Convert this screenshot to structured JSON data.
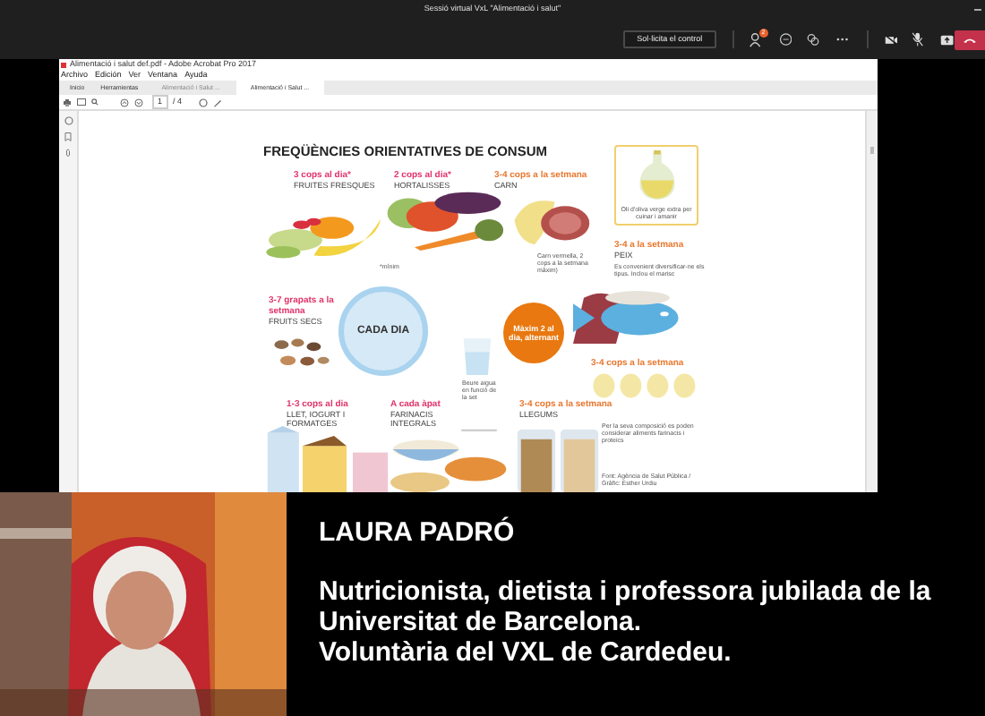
{
  "window": {
    "title": "Sessió virtual VxL \"Alimentació i salut\""
  },
  "toolbar": {
    "control_button": "Sol·licita el control",
    "participants_badge": "2"
  },
  "viewer": {
    "title": "Alimentació i salut def.pdf - Adobe Acrobat Pro 2017",
    "menu": [
      "Archivo",
      "Edición",
      "Ver",
      "Ventana",
      "Ayuda"
    ],
    "tabs": [
      {
        "label": "Inicio",
        "selected": false
      },
      {
        "label": "Herramientas",
        "selected": false
      },
      {
        "label": "Alimentació i Salut ...",
        "selected": false
      },
      {
        "label": "Alimentació i Salut ...",
        "selected": true
      }
    ],
    "page": "1",
    "page_total": "/ 4"
  },
  "poster": {
    "title": "FREQÜÈNCIES ORIENTATIVES DE CONSUM",
    "groups": [
      {
        "frequency": "3 cops al dia*",
        "food": "FRUITES FRESQUES",
        "color": "#e0336a"
      },
      {
        "frequency": "2 cops al dia*",
        "food": "HORTALISSES",
        "color": "#e0336a"
      },
      {
        "frequency": "3-4  cops a la setmana",
        "food": "CARN",
        "color": "#e8772e"
      },
      {
        "frequency": "3-4 a la setmana",
        "food": "PEIX",
        "color": "#e8772e"
      },
      {
        "frequency": "3-7 grapats a la setmana",
        "food": "FRUITS SECS",
        "color": "#e0336a"
      },
      {
        "frequency": "3-4 cops a la setmana",
        "color": "#e8772e"
      },
      {
        "frequency": "1-3 cops al dia",
        "food": "LLET, IOGURT I FORMATGES",
        "color": "#e0336a"
      },
      {
        "frequency": "A cada àpat",
        "food": "FARINACIS INTEGRALS",
        "color": "#e0336a"
      },
      {
        "frequency": "3-4 cops a la setmana",
        "food": "LLEGUMS",
        "color": "#e8772e"
      }
    ],
    "hubs": [
      {
        "label": "CADA DIA",
        "kind": "daily"
      },
      {
        "label": "Màxim 2 al dia, alternant",
        "kind": "limit"
      }
    ],
    "notes": [
      "*mínim",
      "Carn vermella, 2 cops a la setmana màxim)",
      "Es convenient diversificar-ne els tipus. Inclou el marisc",
      "Beure aigua en funció de la set",
      "Per la seva composició es poden considerar aliments farinacis i proteics",
      "Font: Agència de Salut Pública / Gràfic: Esther Urdiu"
    ],
    "oil_note": "Oli d'oliva verge extra per cuinar i amanir"
  },
  "caption": {
    "name": "LAURA PADRÓ",
    "bio_lines": [
      "Nutricionista, dietista i professora jubilada de la",
      "Universitat de Barcelona.",
      "Voluntària del VXL de Cardedeu."
    ]
  }
}
